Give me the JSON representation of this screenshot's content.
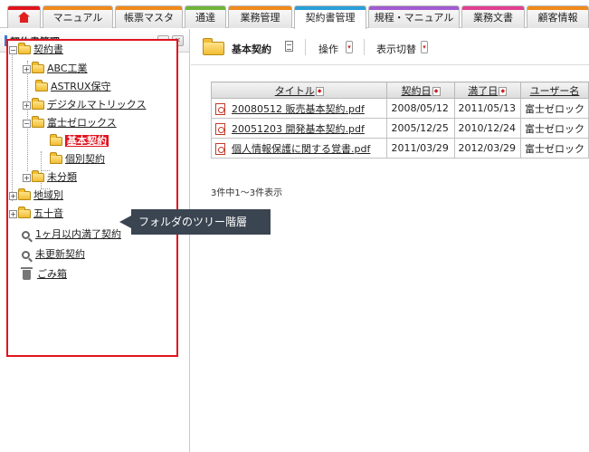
{
  "tabs": [
    {
      "key": "home",
      "label": "",
      "color": "#e0141e",
      "icon": "home-icon"
    },
    {
      "key": "manual",
      "label": "マニュアル",
      "color": "#f08a1c"
    },
    {
      "key": "forms",
      "label": "帳票マスタ",
      "color": "#f08a1c"
    },
    {
      "key": "notice",
      "label": "通達",
      "color": "#6fb43a"
    },
    {
      "key": "business",
      "label": "業務管理",
      "color": "#f08a1c"
    },
    {
      "key": "contracts",
      "label": "契約書管理",
      "color": "#2a9fd8",
      "active": true
    },
    {
      "key": "rules",
      "label": "規程・マニュアル",
      "color": "#a25bd0"
    },
    {
      "key": "bizdocs",
      "label": "業務文書",
      "color": "#e04090"
    },
    {
      "key": "customer",
      "label": "顧客情報",
      "color": "#f08a1c"
    }
  ],
  "left_pane": {
    "title": "契約書管理",
    "tree": {
      "root": "契約書",
      "abc": "ABC工業",
      "astrux": "ASTRUX保守",
      "digital": "デジタルマトリックス",
      "fuji": "富士ゼロックス",
      "basic": "基本契約",
      "individual": "個別契約",
      "unclassified": "未分類",
      "region": "地域別",
      "gojuon": "五十音"
    },
    "search_expire": "1ヶ月以内満了契約",
    "search_unrenewed": "未更新契約",
    "trash": "ごみ箱"
  },
  "callout": "フォルダのツリー階層",
  "toolbar": {
    "title": "基本契約",
    "action_label": "操作",
    "view_label": "表示切替"
  },
  "table": {
    "headers": {
      "title": "タイトル",
      "contract_date": "契約日",
      "expire_date": "満了日",
      "user": "ユーザー名"
    },
    "rows": [
      {
        "title": "20080512 販売基本契約.pdf",
        "contract_date": "2008/05/12",
        "expire_date": "2011/05/13",
        "user": "富士ゼロック"
      },
      {
        "title": "20051203 開発基本契約.pdf",
        "contract_date": "2005/12/25",
        "expire_date": "2010/12/24",
        "user": "富士ゼロック"
      },
      {
        "title": "個人情報保護に関する覚書.pdf",
        "contract_date": "2011/03/29",
        "expire_date": "2012/03/29",
        "user": "富士ゼロック"
      }
    ]
  },
  "count_text": "3件中1～3件表示"
}
